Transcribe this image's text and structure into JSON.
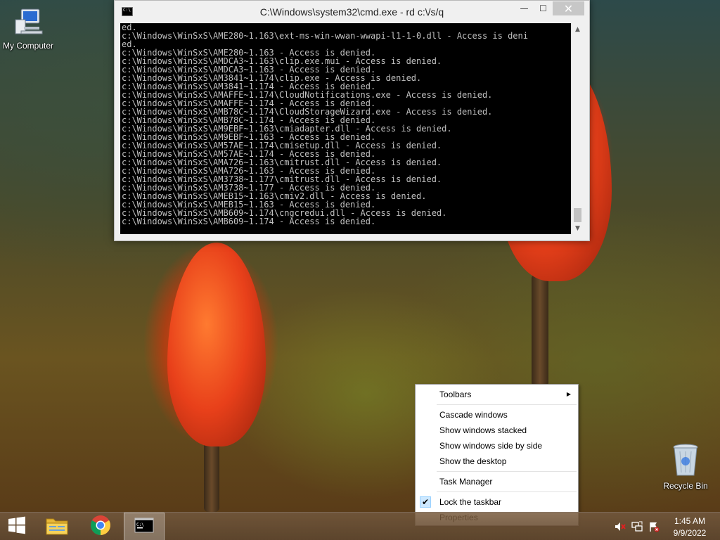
{
  "desktop": {
    "icons": [
      {
        "label": "My Computer",
        "icon": "computer-icon"
      },
      {
        "label": "Recycle Bin",
        "icon": "recycle-bin-icon"
      }
    ]
  },
  "cmd_window": {
    "title": "C:\\Windows\\system32\\cmd.exe - rd  c:\\/s/q",
    "buttons": {
      "minimize": "—",
      "maximize": "☐",
      "close": "✕"
    },
    "lines": [
      "ed.",
      "c:\\Windows\\WinSxS\\AME280~1.163\\ext-ms-win-wwan-wwapi-l1-1-0.dll - Access is deni",
      "ed.",
      "c:\\Windows\\WinSxS\\AME280~1.163 - Access is denied.",
      "c:\\Windows\\WinSxS\\AMDCA3~1.163\\clip.exe.mui - Access is denied.",
      "c:\\Windows\\WinSxS\\AMDCA3~1.163 - Access is denied.",
      "c:\\Windows\\WinSxS\\AM3841~1.174\\clip.exe - Access is denied.",
      "c:\\Windows\\WinSxS\\AM3841~1.174 - Access is denied.",
      "c:\\Windows\\WinSxS\\AMAFFE~1.174\\CloudNotifications.exe - Access is denied.",
      "c:\\Windows\\WinSxS\\AMAFFE~1.174 - Access is denied.",
      "c:\\Windows\\WinSxS\\AMB78C~1.174\\CloudStorageWizard.exe - Access is denied.",
      "c:\\Windows\\WinSxS\\AMB78C~1.174 - Access is denied.",
      "c:\\Windows\\WinSxS\\AM9EBF~1.163\\cmiadapter.dll - Access is denied.",
      "c:\\Windows\\WinSxS\\AM9EBF~1.163 - Access is denied.",
      "c:\\Windows\\WinSxS\\AM57AE~1.174\\cmisetup.dll - Access is denied.",
      "c:\\Windows\\WinSxS\\AM57AE~1.174 - Access is denied.",
      "c:\\Windows\\WinSxS\\AMA726~1.163\\cmitrust.dll - Access is denied.",
      "c:\\Windows\\WinSxS\\AMA726~1.163 - Access is denied.",
      "c:\\Windows\\WinSxS\\AM3738~1.177\\cmitrust.dll - Access is denied.",
      "c:\\Windows\\WinSxS\\AM3738~1.177 - Access is denied.",
      "c:\\Windows\\WinSxS\\AMEB15~1.163\\cmiv2.dll - Access is denied.",
      "c:\\Windows\\WinSxS\\AMEB15~1.163 - Access is denied.",
      "c:\\Windows\\WinSxS\\AMB609~1.174\\cngcredui.dll - Access is denied.",
      "c:\\Windows\\WinSxS\\AMB609~1.174 - Access is denied."
    ]
  },
  "context_menu": {
    "items": [
      {
        "label": "Toolbars",
        "submenu": true
      },
      {
        "separator": true
      },
      {
        "label": "Cascade windows"
      },
      {
        "label": "Show windows stacked"
      },
      {
        "label": "Show windows side by side"
      },
      {
        "label": "Show the desktop"
      },
      {
        "separator": true
      },
      {
        "label": "Task Manager"
      },
      {
        "separator": true
      },
      {
        "label": "Lock the taskbar",
        "checked": true
      },
      {
        "label": "Properties"
      }
    ]
  },
  "taskbar": {
    "buttons": [
      {
        "name": "start",
        "icon": "windows-logo-icon"
      },
      {
        "name": "file-explorer",
        "icon": "folder-icon"
      },
      {
        "name": "chrome",
        "icon": "chrome-icon"
      },
      {
        "name": "cmd",
        "icon": "cmd-icon",
        "active": true
      }
    ],
    "tray": {
      "icons": [
        "speaker-muted-icon",
        "network-icon",
        "action-center-flag-icon"
      ],
      "time": "1:45 AM",
      "date": "9/9/2022"
    }
  }
}
